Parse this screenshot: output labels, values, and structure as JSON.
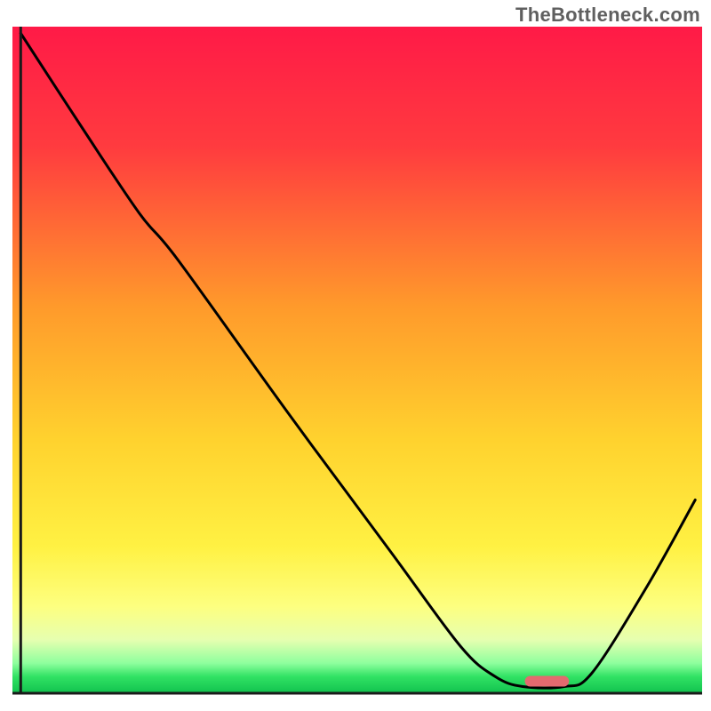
{
  "watermark": "TheBottleneck.com",
  "chart_data": {
    "type": "line",
    "title": "",
    "xlabel": "",
    "ylabel": "",
    "xlim": [
      0,
      100
    ],
    "ylim": [
      0,
      100
    ],
    "grid": false,
    "legend": false,
    "background_gradient": {
      "direction": "vertical",
      "stops": [
        {
          "pos": 0.0,
          "color": "#ff1a47"
        },
        {
          "pos": 0.18,
          "color": "#ff3b3f"
        },
        {
          "pos": 0.42,
          "color": "#ff9a2b"
        },
        {
          "pos": 0.62,
          "color": "#ffd22e"
        },
        {
          "pos": 0.78,
          "color": "#fff143"
        },
        {
          "pos": 0.87,
          "color": "#fdff80"
        },
        {
          "pos": 0.92,
          "color": "#e6ffb0"
        },
        {
          "pos": 0.955,
          "color": "#8eff9e"
        },
        {
          "pos": 0.975,
          "color": "#31e264"
        },
        {
          "pos": 1.0,
          "color": "#11c24e"
        }
      ]
    },
    "curve_points": [
      {
        "x": 1.2,
        "y": 99.0
      },
      {
        "x": 10.0,
        "y": 85.0
      },
      {
        "x": 18.4,
        "y": 72.0
      },
      {
        "x": 24.0,
        "y": 65.0
      },
      {
        "x": 40.0,
        "y": 42.0
      },
      {
        "x": 55.0,
        "y": 21.0
      },
      {
        "x": 65.0,
        "y": 7.0
      },
      {
        "x": 70.0,
        "y": 2.5
      },
      {
        "x": 74.0,
        "y": 1.0
      },
      {
        "x": 80.0,
        "y": 1.0
      },
      {
        "x": 84.0,
        "y": 3.0
      },
      {
        "x": 92.0,
        "y": 16.0
      },
      {
        "x": 99.0,
        "y": 29.0
      }
    ],
    "marker": {
      "x_center": 77.5,
      "x_halfwidth": 3.2,
      "y": 1.8,
      "color": "#e36a6f",
      "shape": "rounded-bar"
    },
    "axes": {
      "left_x": 1.2,
      "bottom_y": 0.0,
      "color": "#1a1a1a",
      "width": 3
    }
  }
}
